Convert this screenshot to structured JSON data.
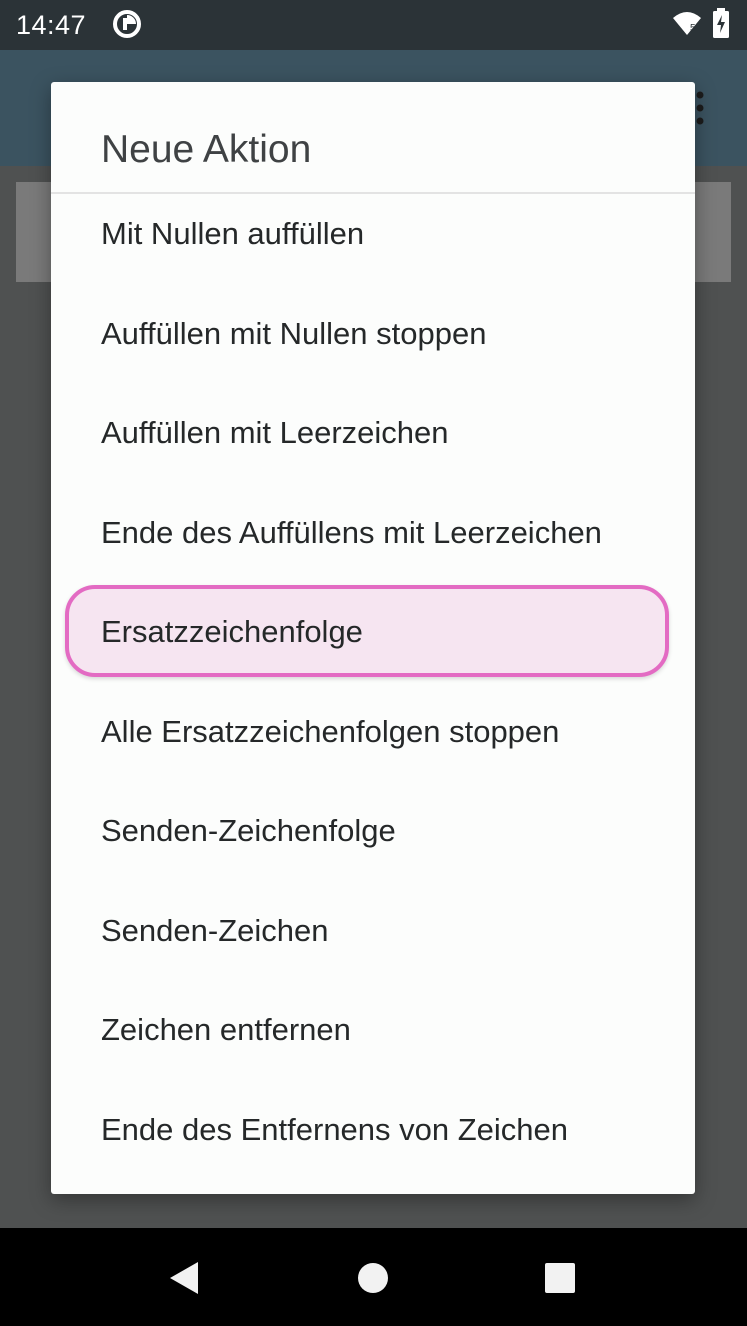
{
  "status_bar": {
    "time": "14:47",
    "icons": [
      "app-notification-icon",
      "wifi-icon",
      "battery-charging-icon"
    ]
  },
  "dialog": {
    "title": "Neue Aktion",
    "items": [
      {
        "label": "Mit Nullen auffüllen"
      },
      {
        "label": "Auffüllen mit Nullen stoppen"
      },
      {
        "label": "Auffüllen mit Leerzeichen"
      },
      {
        "label": "Ende des Auffüllens mit Leerzeichen"
      },
      {
        "label": "Ersatzzeichenfolge",
        "highlighted": true
      },
      {
        "label": "Alle Ersatzzeichenfolgen stoppen"
      },
      {
        "label": "Senden-Zeichenfolge"
      },
      {
        "label": "Senden-Zeichen"
      },
      {
        "label": "Zeichen entfernen"
      },
      {
        "label": "Ende des Entfernens von Zeichen"
      }
    ],
    "highlight_color": "#e36bc3"
  },
  "nav_bar": {
    "icons": [
      "back-icon",
      "home-icon",
      "recents-icon"
    ]
  }
}
